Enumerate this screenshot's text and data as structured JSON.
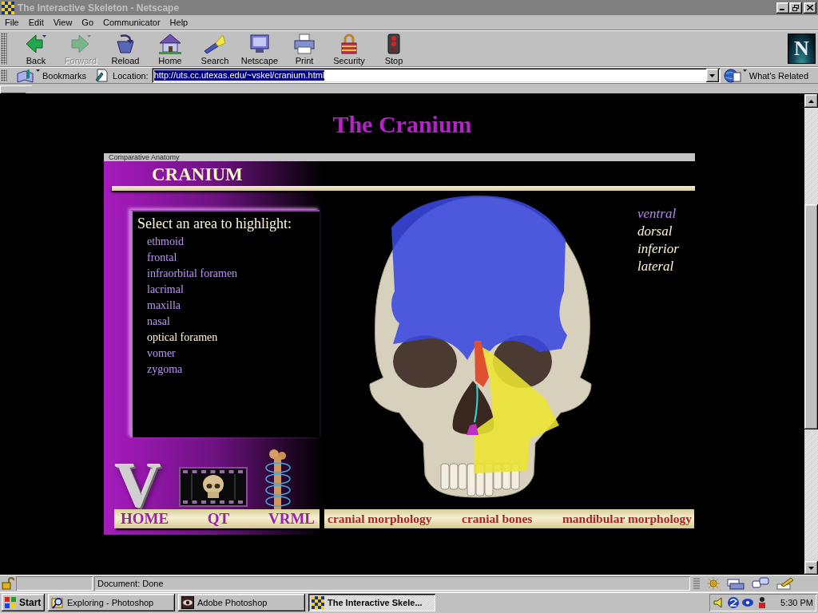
{
  "window": {
    "title": "The Interactive Skeleton - Netscape"
  },
  "menu": [
    "File",
    "Edit",
    "View",
    "Go",
    "Communicator",
    "Help"
  ],
  "toolbar": {
    "buttons": [
      {
        "kind": "back",
        "label": "Back",
        "disabled": false
      },
      {
        "kind": "forward",
        "label": "Forward",
        "disabled": true
      },
      {
        "kind": "reload",
        "label": "Reload",
        "disabled": false
      },
      {
        "kind": "home",
        "label": "Home",
        "disabled": false
      },
      {
        "kind": "search",
        "label": "Search",
        "disabled": false
      },
      {
        "kind": "portal",
        "label": "Netscape",
        "disabled": false
      },
      {
        "kind": "print",
        "label": "Print",
        "disabled": false
      },
      {
        "kind": "security",
        "label": "Security",
        "disabled": false
      },
      {
        "kind": "stop",
        "label": "Stop",
        "disabled": false
      }
    ],
    "logo": "N"
  },
  "location_bar": {
    "bookmarks": "Bookmarks",
    "label": "Location:",
    "url": "http://uts.cc.utexas.edu/~vskel/cranium.html",
    "url_selected": true,
    "related": "What's Related"
  },
  "page": {
    "title": "The Cranium",
    "banner": "Comparative Anatomy",
    "heading": "CRANIUM",
    "prompt": "Select an area to highlight:",
    "areas": [
      {
        "label": "ethmoid",
        "selected": false
      },
      {
        "label": "frontal",
        "selected": false
      },
      {
        "label": "infraorbital foramen",
        "selected": false
      },
      {
        "label": "lacrimal",
        "selected": false
      },
      {
        "label": "maxilla",
        "selected": false
      },
      {
        "label": "nasal",
        "selected": false
      },
      {
        "label": "optical foramen",
        "selected": true
      },
      {
        "label": "vomer",
        "selected": false
      },
      {
        "label": "zygoma",
        "selected": false
      }
    ],
    "views": [
      {
        "label": "ventral",
        "selected": true
      },
      {
        "label": "dorsal",
        "selected": false
      },
      {
        "label": "inferior",
        "selected": false
      },
      {
        "label": "lateral",
        "selected": false
      }
    ],
    "logo": "V",
    "nav_left": [
      "HOME",
      "QT",
      "VRML"
    ],
    "nav_right": [
      "cranial morphology",
      "cranial bones",
      "mandibular morphology"
    ]
  },
  "status_bar": {
    "text": "Document: Done"
  },
  "taskbar": {
    "start": "Start",
    "tasks": [
      {
        "kind": "explorer",
        "label": "Exploring - Photoshop",
        "selected": false
      },
      {
        "kind": "photoshop",
        "label": "Adobe Photoshop",
        "selected": false
      },
      {
        "kind": "browser",
        "label": "The Interactive Skele...",
        "selected": true
      }
    ],
    "clock": "5:30 PM"
  }
}
